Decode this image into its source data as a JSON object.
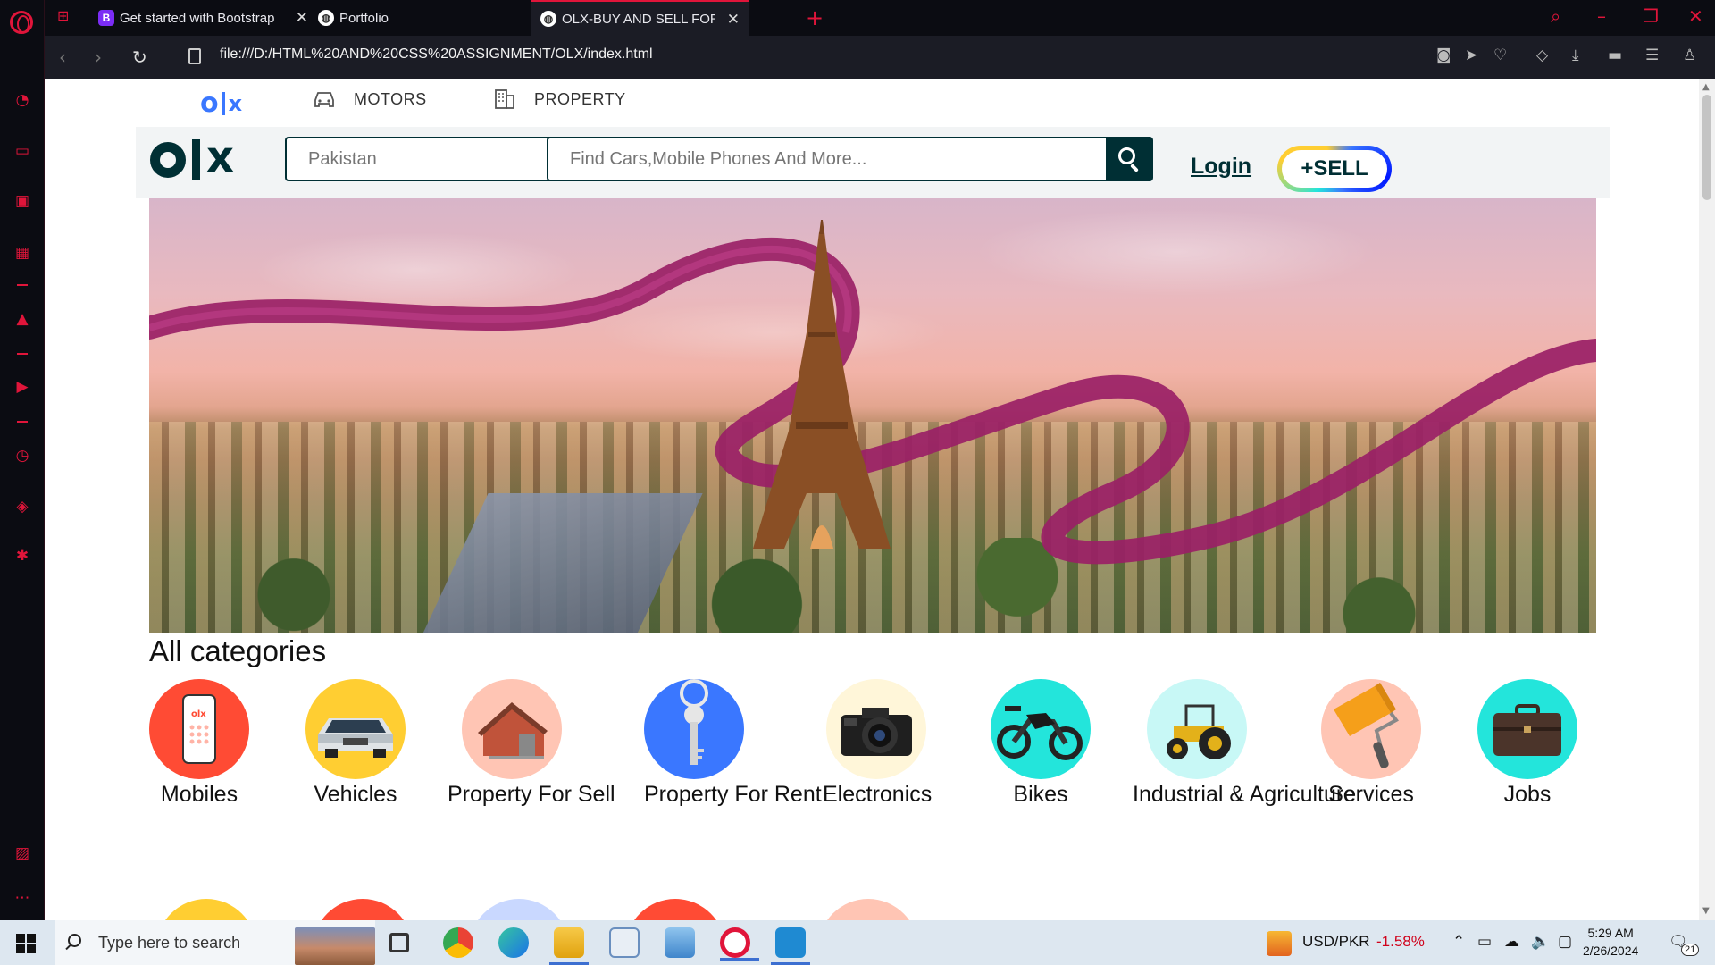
{
  "browser": {
    "tabs": [
      {
        "title": "Get started with Bootstrap",
        "favicon": "B"
      },
      {
        "title": "Portfolio"
      },
      {
        "title": "OLX-BUY AND SELL FOR FREE"
      }
    ],
    "url": "file:///D:/HTML%20AND%20CSS%20ASSIGNMENT/OLX/index.html",
    "accent_color": "#e0153a"
  },
  "site": {
    "topnav": {
      "motors": "MOTORS",
      "property": "PROPERTY"
    },
    "header": {
      "location_placeholder": "Pakistan",
      "search_placeholder": "Find Cars,Mobile Phones And More...",
      "login_label": "Login",
      "sell_label": "+SELL"
    },
    "categories_title": "All categories",
    "categories": [
      {
        "label": "Mobiles",
        "icon": "mobile-phone-icon",
        "color": "#ff4b34"
      },
      {
        "label": "Vehicles",
        "icon": "car-icon",
        "color": "#ffce32"
      },
      {
        "label": "Property For Sell",
        "icon": "house-icon",
        "color": "#ffc5b4"
      },
      {
        "label": "Property For Rent",
        "icon": "key-icon",
        "color": "#3a77ff"
      },
      {
        "label": "Electronics",
        "icon": "camera-icon",
        "color": "#fff6d9"
      },
      {
        "label": "Bikes",
        "icon": "motorbike-icon",
        "color": "#23e5db"
      },
      {
        "label": "Industrial & Agriculture",
        "icon": "tractor-icon",
        "color": "#c8f8f6"
      },
      {
        "label": "Services",
        "icon": "paint-roller-icon",
        "color": "#ffc5b4"
      },
      {
        "label": "Jobs",
        "icon": "briefcase-icon",
        "color": "#23e5db"
      }
    ],
    "brand_color": "#002f34"
  },
  "taskbar": {
    "search_placeholder": "Type here to search",
    "currency": "USD/PKR",
    "currency_change": "-1.58%",
    "time": "5:29 AM",
    "date": "2/26/2024",
    "notification_count": "21"
  }
}
